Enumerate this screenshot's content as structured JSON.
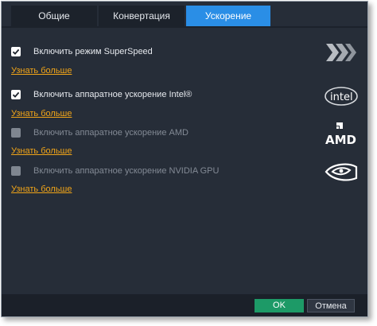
{
  "tabs": [
    {
      "label": "Общие",
      "active": false
    },
    {
      "label": "Конвертация",
      "active": false
    },
    {
      "label": "Ускорение",
      "active": true
    }
  ],
  "options": [
    {
      "label": "Включить режим SuperSpeed",
      "checked": true,
      "enabled": true,
      "link": "Узнать больше",
      "logo": "superspeed-logo"
    },
    {
      "label": "Включить аппаратное ускорение Intel®",
      "checked": true,
      "enabled": true,
      "link": "Узнать больше",
      "logo": "intel-logo"
    },
    {
      "label": "Включить аппаратное ускорение AMD",
      "checked": false,
      "enabled": false,
      "link": "Узнать больше",
      "logo": "amd-logo",
      "logo_text": "AMD"
    },
    {
      "label": "Включить аппаратное ускорение NVIDIA GPU",
      "checked": false,
      "enabled": false,
      "link": "Узнать больше",
      "logo": "nvidia-logo"
    }
  ],
  "footer": {
    "ok_label": "OK",
    "cancel_label": "Отмена"
  },
  "colors": {
    "background": "#262d38",
    "active_tab": "#2a8ee6",
    "link": "#f0a418",
    "ok_button": "#1d9a67"
  }
}
